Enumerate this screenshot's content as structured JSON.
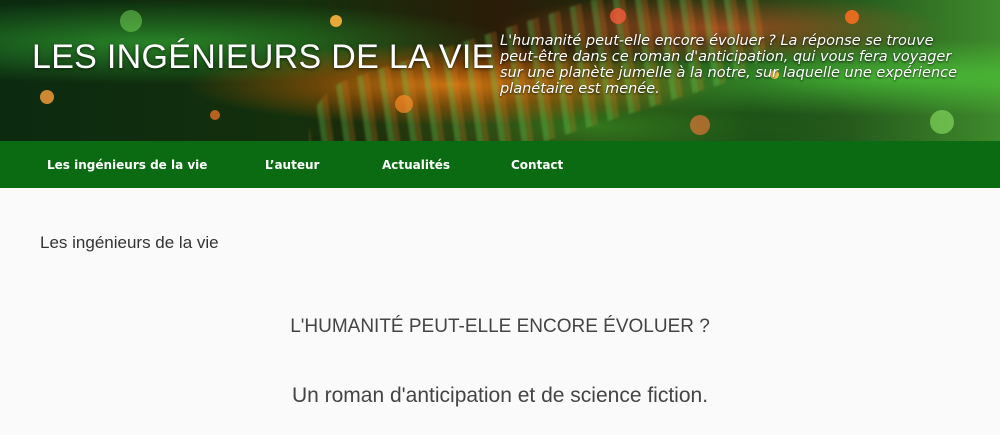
{
  "header": {
    "site_title": "LES INGÉNIEURS DE LA VIE",
    "tagline": "L'humanité peut-elle encore évoluer ? La réponse se trouve peut-être dans ce roman d'anticipation, qui vous fera voyager sur une planète jumelle à la notre, sur laquelle une expérience planétaire est menée."
  },
  "nav": {
    "items": [
      {
        "label": "Les ingénieurs de la vie"
      },
      {
        "label": "L’auteur"
      },
      {
        "label": "Actualités"
      },
      {
        "label": "Contact"
      }
    ]
  },
  "main": {
    "breadcrumb": "Les ingénieurs de la vie",
    "heading": "L'HUMANITÉ PEUT-ELLE ENCORE ÉVOLUER ?",
    "subheading": "Un roman d'anticipation et de science fiction."
  },
  "colors": {
    "nav_bg": "#0b6b12",
    "text": "#444444"
  }
}
